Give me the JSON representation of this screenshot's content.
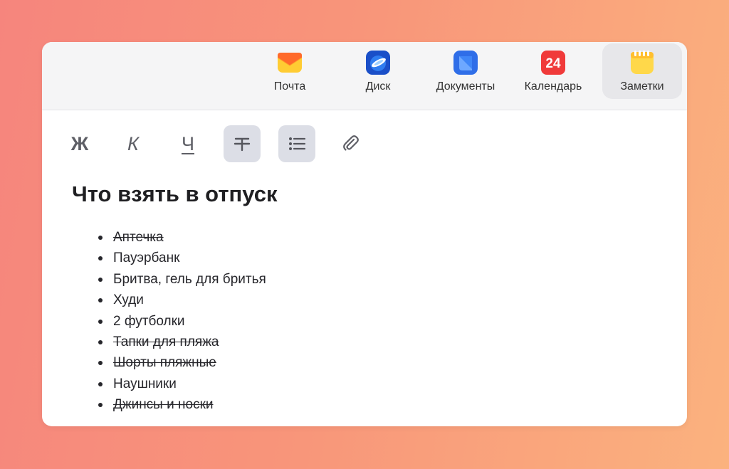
{
  "services": [
    {
      "label": "Почта",
      "icon": "mail-icon",
      "active": false
    },
    {
      "label": "Диск",
      "icon": "disk-icon",
      "active": false
    },
    {
      "label": "Документы",
      "icon": "documents-icon",
      "active": false
    },
    {
      "label": "Календарь",
      "icon": "calendar-icon",
      "active": false,
      "badge": "24"
    },
    {
      "label": "Заметки",
      "icon": "notes-icon",
      "active": true
    }
  ],
  "toolbar": {
    "bold": {
      "glyph": "Ж",
      "icon": "bold-icon"
    },
    "italic": {
      "glyph": "К",
      "icon": "italic-icon"
    },
    "underline": {
      "glyph": "Ч",
      "icon": "underline-icon"
    },
    "strikethrough": {
      "icon": "strikethrough-icon",
      "active": true
    },
    "list": {
      "icon": "bulleted-list-icon",
      "active": true
    },
    "attach": {
      "icon": "paperclip-icon"
    }
  },
  "note": {
    "title": "Что взять в отпуск",
    "items": [
      {
        "text": "Аптечка",
        "done": true
      },
      {
        "text": "Пауэрбанк",
        "done": false
      },
      {
        "text": "Бритва, гель для бритья",
        "done": false
      },
      {
        "text": "Худи",
        "done": false
      },
      {
        "text": "2 футболки",
        "done": false
      },
      {
        "text": "Тапки для пляжа",
        "done": true
      },
      {
        "text": "Шорты пляжные",
        "done": true
      },
      {
        "text": "Наушники",
        "done": false
      },
      {
        "text": "Джинсы и носки",
        "done": true
      }
    ]
  },
  "colors": {
    "mail": "#ffcc33",
    "disk": "#1d5bd8",
    "documents": "#3a78f0",
    "calendar": "#f03a3a",
    "notes": "#ffd84a",
    "toolbar_active_bg": "#dcdee6"
  }
}
